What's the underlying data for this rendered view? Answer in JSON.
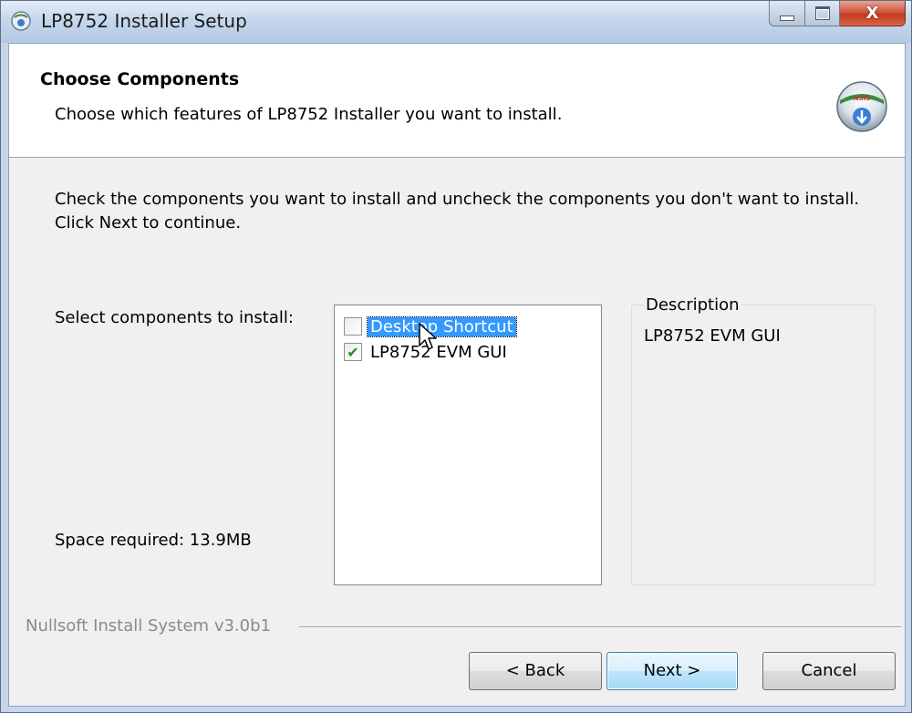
{
  "window": {
    "title": "LP8752 Installer Setup",
    "close_glyph": "X"
  },
  "header": {
    "title": "Choose Components",
    "subtitle": "Choose which features of LP8752 Installer you want to install."
  },
  "instructions": "Check the components you want to install and uncheck the components you don't want to install. Click Next to continue.",
  "select_label": "Select components to install:",
  "space_required": "Space required: 13.9MB",
  "components": [
    {
      "label": "Desktop Shortcut",
      "checked": false,
      "selected": true
    },
    {
      "label": "LP8752 EVM GUI",
      "checked": true,
      "selected": false
    }
  ],
  "description": {
    "legend": "Description",
    "text": "LP8752 EVM GUI"
  },
  "branding": "Nullsoft Install System v3.0b1",
  "buttons": {
    "back": "< Back",
    "next": "Next >",
    "cancel": "Cancel"
  },
  "colors": {
    "selection": "#3399ff",
    "check": "#2a8a2a",
    "close_button": "#c23b20"
  },
  "icons": {
    "app": "installer-disc-icon",
    "header": "installer-globe-icon",
    "checkmark": "✔"
  }
}
